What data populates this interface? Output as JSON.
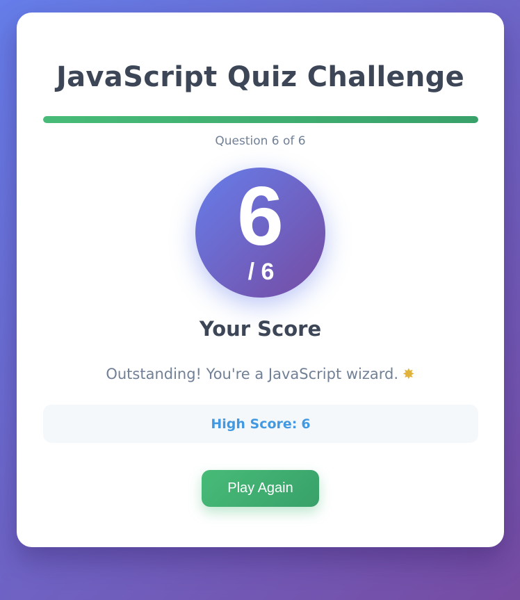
{
  "quiz": {
    "title": "JavaScript Quiz Challenge",
    "progress_fraction": 1.0,
    "question_counter": "Question 6 of 6"
  },
  "result": {
    "score": "6",
    "total_label": "/ 6",
    "heading": "Your Score",
    "message": "Outstanding! You're a JavaScript wizard.",
    "message_icon": "sparkle-icon"
  },
  "high_score": {
    "label": "High Score:",
    "value": "6"
  },
  "actions": {
    "play_again_label": "Play Again"
  },
  "colors": {
    "background_gradient_start": "#667eea",
    "background_gradient_end": "#764ba2",
    "progress_green": "#48bb78",
    "high_score_blue": "#4299e1",
    "title_text": "#3c4656",
    "muted_text": "#718096"
  }
}
